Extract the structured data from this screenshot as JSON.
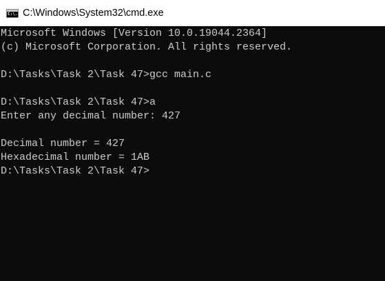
{
  "window": {
    "title": "C:\\Windows\\System32\\cmd.exe",
    "icon": "cmd-icon",
    "icon_text": "C:\\."
  },
  "console": {
    "lines": [
      "Microsoft Windows [Version 10.0.19044.2364]",
      "(c) Microsoft Corporation. All rights reserved.",
      "",
      "D:\\Tasks\\Task 2\\Task 47>gcc main.c",
      "",
      "D:\\Tasks\\Task 2\\Task 47>a",
      "Enter any decimal number: 427",
      "",
      "Decimal number = 427",
      "Hexadecimal number = 1AB",
      "D:\\Tasks\\Task 2\\Task 47>"
    ]
  },
  "colors": {
    "titlebar_bg": "#ffffff",
    "console_bg": "#0c0c0c",
    "console_text": "#cccccc"
  }
}
